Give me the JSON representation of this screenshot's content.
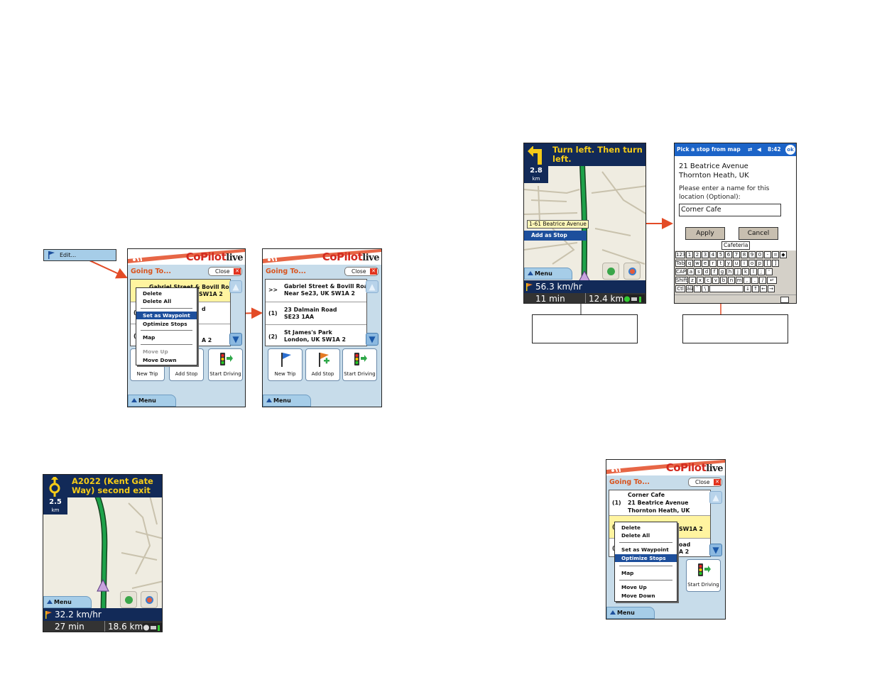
{
  "brand": {
    "name": "CoPilot",
    "suffix": "live"
  },
  "edit_button": {
    "label": "Edit..."
  },
  "going_to": {
    "title": "Going To...",
    "close": "Close",
    "actions": {
      "new_trip": "New Trip",
      "add_stop": "Add Stop",
      "start_driving": "Start Driving"
    },
    "menu": "Menu"
  },
  "screen1": {
    "rows": [
      {
        "num": "",
        "line1": "Gabriel Street & Bovill Roa",
        "line2": "SW1A 2"
      },
      {
        "num": "(",
        "line1": "d",
        "line2": ""
      },
      {
        "num": "(",
        "line1": "",
        "line2": "A 2"
      }
    ],
    "context_menu": {
      "items": [
        "Delete",
        "Delete All",
        "Set as Waypoint",
        "Optimize Stops",
        "Map",
        "Move Up",
        "Move Down"
      ],
      "selected": "Set as Waypoint",
      "disabled": [
        "Move Up"
      ]
    }
  },
  "screen2": {
    "rows": [
      {
        "num": ">>",
        "line1": "Gabriel Street & Bovill Roa",
        "line2": "Near Se23, UK SW1A 2"
      },
      {
        "num": "(1)",
        "line1": "23 Dalmain Road",
        "line2": "SE23 1AA"
      },
      {
        "num": "(2)",
        "line1": "St James's Park",
        "line2": "London, UK SW1A 2"
      }
    ]
  },
  "screen3": {
    "rows": [
      {
        "num": "(1)",
        "line1": "Corner Cafe",
        "line2": "21 Beatrice Avenue",
        "line3": "Thornton Heath, UK"
      },
      {
        "num": "(",
        "line1": "",
        "line2": "SW1A 2"
      },
      {
        "num": "(",
        "line1": "oad",
        "line2": "A 2"
      }
    ],
    "context_menu": {
      "items": [
        "Delete",
        "Delete All",
        "Set as Waypoint",
        "Optimize Stops",
        "Map",
        "Move Up",
        "Move Down"
      ],
      "selected": "Optimize Stops",
      "disabled": []
    }
  },
  "nav1": {
    "instruction": "Turn left.  Then turn left.",
    "distance": "2.8",
    "distance_unit": "km",
    "street_label": "1-61 Beatrice Avenue",
    "add_as_stop": "Add as Stop",
    "menu": "Menu",
    "speed": "56.3 km/hr",
    "time": "11 min",
    "remaining": "12.4 km"
  },
  "nav2": {
    "instruction": "A2022 (Kent Gate Way) second exit",
    "distance": "2.5",
    "distance_unit": "km",
    "menu": "Menu",
    "speed": "32.2 km/hr",
    "time": "27 min",
    "remaining": "18.6 km"
  },
  "pick_stop": {
    "title": "Pick a stop from map",
    "clock": "8:42",
    "ok": "ok",
    "address1": "21 Beatrice Avenue",
    "address2": "Thornton Heath, UK",
    "prompt": "Please enter a name for this location (Optional):",
    "value": "Corner Cafe",
    "apply": "Apply",
    "cancel": "Cancel",
    "tooltip": "Cafeteria",
    "keyboard": [
      [
        "123",
        "1",
        "2",
        "3",
        "4",
        "5",
        "6",
        "7",
        "8",
        "9",
        "0",
        "-",
        "=",
        "◆"
      ],
      [
        "Tab",
        "q",
        "w",
        "e",
        "r",
        "t",
        "y",
        "u",
        "i",
        "o",
        "p",
        "[",
        "]"
      ],
      [
        "CAP",
        "a",
        "s",
        "d",
        "f",
        "g",
        "h",
        "j",
        "k",
        "l",
        ";",
        "'"
      ],
      [
        "Shift",
        "z",
        "x",
        "c",
        "v",
        "b",
        "n",
        "m",
        ",",
        ".",
        "/",
        "↵"
      ],
      [
        "Ctl",
        "áü",
        "`",
        "\\",
        "",
        "↓",
        "↑",
        "←",
        "→"
      ]
    ]
  },
  "colors": {
    "accent_red": "#e34b26",
    "nav_blue": "#122a58",
    "route_green": "#1ea24a",
    "highlight_yellow": "#fff4a0",
    "selection_blue": "#1d4f9c"
  }
}
